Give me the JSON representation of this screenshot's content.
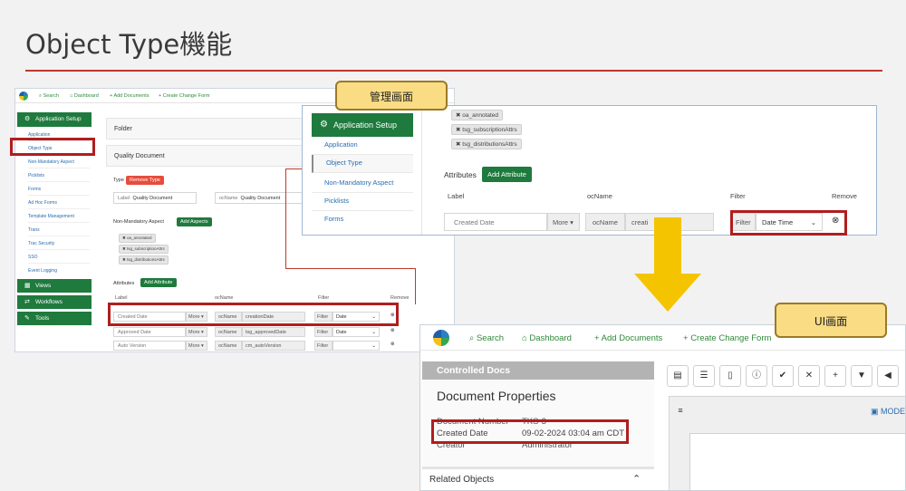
{
  "slide_title": "Object Type機能",
  "callouts": {
    "admin": "管理画面",
    "ui": "UI画面"
  },
  "admin_small": {
    "topnav": {
      "search": "Search",
      "dashboard": "Dashboard",
      "add_documents": "Add Documents",
      "create_change_form": "Create Change Form"
    },
    "sidebar": {
      "header": "Application Setup",
      "items": [
        "Application",
        "Object Type",
        "Non-Mandatory Aspect",
        "Picklists",
        "Forms",
        "Ad Hoc Forms",
        "Template Management",
        "Trans",
        "Trac Security",
        "SSO",
        "Event Logging"
      ],
      "sections": [
        "Views",
        "Workflows",
        "Tools"
      ]
    },
    "folder_label": "Folder",
    "quality_doc_label": "Quality Document",
    "type_label": "Type",
    "remove_type": "Remove Type",
    "label_caption": "Label",
    "label_value": "Quality Document",
    "ocname_caption": "ocName",
    "ocname_value": "Quality Document",
    "non_mandatory_label": "Non-Mandatory Aspect",
    "add_aspects": "Add Aspects",
    "chips": [
      "oa_annotated",
      "tsg_subscriptionAttrs",
      "tsg_distributionsAttrs"
    ],
    "attributes_label": "Attributes",
    "add_attribute": "Add Attribute",
    "columns": [
      "Label",
      "ocName",
      "Filter",
      "Remove"
    ],
    "more_label": "More",
    "filter_label": "Filter",
    "rows": [
      {
        "label": "Created Date",
        "ocname": "creationDate",
        "filter": "Date"
      },
      {
        "label": "Approved Date",
        "ocname": "tsg_approvedDate",
        "filter": "Date"
      },
      {
        "label": "Auto Version",
        "ocname": "cm_autoVersion",
        "filter": ""
      }
    ]
  },
  "admin_zoom": {
    "sidebar_header": "Application Setup",
    "items": [
      "Application",
      "Object Type",
      "Non-Mandatory Aspect",
      "Picklists",
      "Forms"
    ],
    "chips": [
      "oa_annotated",
      "tsg_subscriptionAttrs",
      "tsg_distributionsAttrs"
    ],
    "attributes_label": "Attributes",
    "add_attribute": "Add Attribute",
    "columns": [
      "Label",
      "ocName",
      "Filter",
      "Remove"
    ],
    "row": {
      "label": "Created Date",
      "more": "More",
      "ocname_caption": "ocName",
      "ocname_value": "creati",
      "filter_caption": "Filter",
      "filter_value": "Date Time"
    }
  },
  "ui_screen": {
    "nav": {
      "search": "Search",
      "dashboard": "Dashboard",
      "add_documents": "Add Documents",
      "create_change_form": "Create Change Form"
    },
    "controlled_docs": "Controlled Docs",
    "doc_props_title": "Document Properties",
    "props": [
      {
        "key": "Document Number",
        "value": "TKS-3"
      },
      {
        "key": "Created Date",
        "value": "09-02-2024 03:04 am CDT"
      },
      {
        "key": "Creator",
        "value": "Administrator"
      }
    ],
    "related_objects": "Related Objects",
    "mode_label": "MODE"
  },
  "colors": {
    "accent_red": "#b01e1e",
    "green": "#1f7a3d",
    "callout": "#f9dc84",
    "arrow": "#f5c400"
  }
}
